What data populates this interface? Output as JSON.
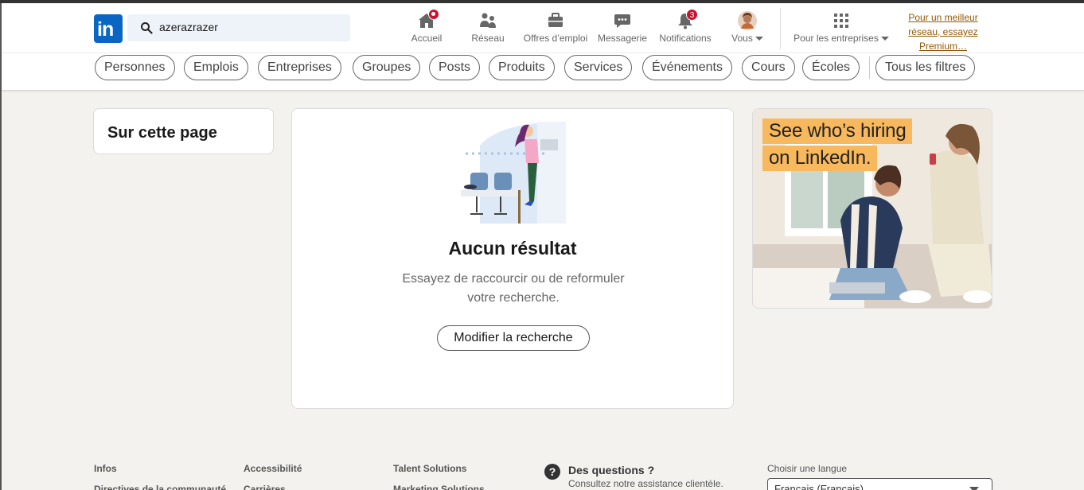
{
  "search": {
    "value": "azerazrazer"
  },
  "nav": {
    "home": "Accueil",
    "network": "Réseau",
    "jobs": "Offres d’emploi",
    "messaging": "Messagerie",
    "notifications": "Notifications",
    "notifications_count": "3",
    "me": "Vous",
    "business": "Pour les entreprises"
  },
  "premium": {
    "line1": "Pour un meilleur",
    "line2": "réseau, essayez",
    "line3": "Premium…"
  },
  "filters": [
    "Personnes",
    "Emplois",
    "Entreprises",
    "Groupes",
    "Posts",
    "Produits",
    "Services",
    "Événements",
    "Cours",
    "Écoles",
    "Tous les filtres"
  ],
  "sidebar": {
    "title": "Sur cette page"
  },
  "results": {
    "title": "Aucun résultat",
    "subtitle": "Essayez de raccourcir ou de reformuler votre recherche.",
    "button": "Modifier la recherche"
  },
  "ad": {
    "line1": "See who’s hiring",
    "line2": "on LinkedIn."
  },
  "footer": {
    "col1": [
      "Infos",
      "Directives de la communauté"
    ],
    "col2": [
      "Accessibilité",
      "Carrières"
    ],
    "col3": [
      "Talent Solutions",
      "Marketing Solutions"
    ],
    "help_title": "Des questions ?",
    "help_sub": "Consultez notre assistance clientèle.",
    "lang_label": "Choisir une langue",
    "lang_value": "Français (Français)"
  },
  "colors": {
    "brand": "#0a66c2",
    "badge": "#cb112d",
    "premium": "#915907",
    "ad_highlight": "#f7b85e"
  }
}
